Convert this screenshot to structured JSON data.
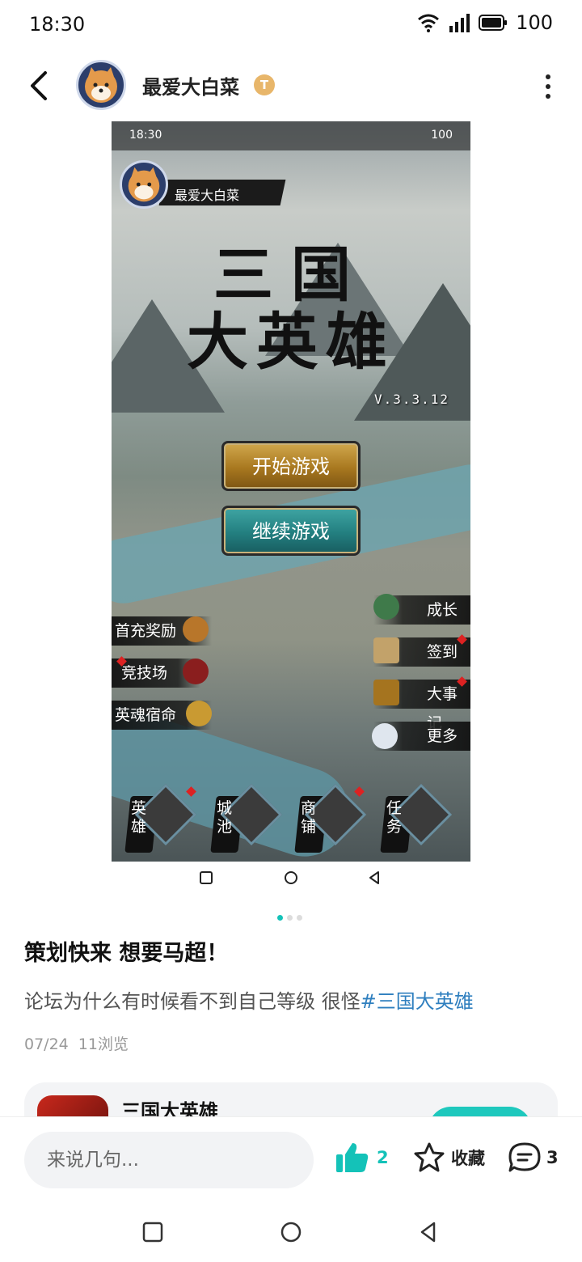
{
  "status_bar": {
    "time": "18:30",
    "battery": "100"
  },
  "header": {
    "author_name": "最爱大白菜",
    "badge": "T"
  },
  "screenshot": {
    "status_time": "18:30",
    "status_battery": "100",
    "profile_name": "最爱大白菜",
    "title_line1": "三国",
    "title_line2": "大英雄",
    "version": "V.3.3.12",
    "start_button": "开始游戏",
    "continue_button": "继续游戏",
    "left_menu": [
      "首充奖励",
      "竞技场",
      "英魂宿命"
    ],
    "right_menu": [
      "成长",
      "签到",
      "大事记",
      "更多"
    ],
    "bottom_tabs": [
      "英雄",
      "城池",
      "商铺",
      "任务"
    ]
  },
  "carousel": {
    "total": 3,
    "active": 0
  },
  "post": {
    "title": "策划快来 想要马超！",
    "body": "论坛为什么有时候看不到自己等级 很怪",
    "hashtag": "#三国大英雄",
    "date": "07/24",
    "views": "11浏览"
  },
  "game_card": {
    "name": "三国大英雄"
  },
  "bottom_bar": {
    "comment_placeholder": "来说几句...",
    "like_count": "2",
    "favorite_label": "收藏",
    "comment_count": "3"
  },
  "colors": {
    "accent": "#14c2b8",
    "hashtag": "#2f7fbf"
  }
}
